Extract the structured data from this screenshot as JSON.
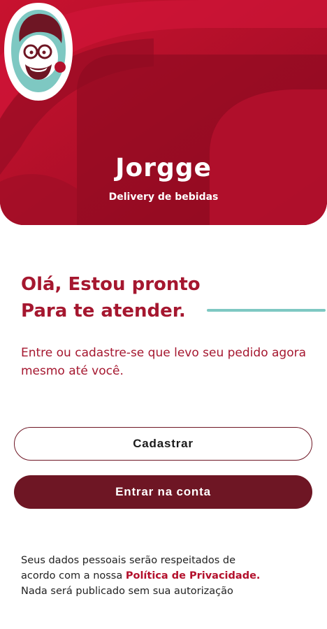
{
  "brand": {
    "name": "Jorgge",
    "tagline": "Delivery de bebidas"
  },
  "headline": {
    "line1": "Olá, Estou pronto",
    "line2": "Para te atender."
  },
  "subtext": "Entre ou cadastre-se que levo seu pedido agora mesmo até você.",
  "buttons": {
    "register": "Cadastrar",
    "login": "Entrar na conta"
  },
  "privacy": {
    "line1": "Seus dados pessoais serão respeitados de",
    "line2_prefix": "acordo com a nossa ",
    "policy_link": "Política de Privacidade.",
    "line3": "Nada será publicado sem sua autorização"
  },
  "colors": {
    "brand_red": "#b3102c",
    "dark_wine": "#6e1624",
    "accent_teal": "#7ec8c2"
  },
  "icons": [
    "mascot-logo"
  ]
}
